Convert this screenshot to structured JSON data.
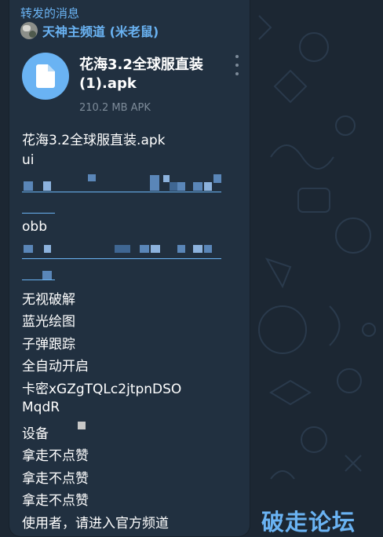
{
  "forwarded_label": "转发的消息",
  "channel_name": "天神主频道 (米老鼠)",
  "file": {
    "name": "花海3.2全球服直装(1).apk",
    "meta": "210.2 MB APK"
  },
  "message_lines": {
    "filename": "花海3.2全球服直装.apk",
    "ui": "ui",
    "obb": "obb",
    "feature1": "无视破解",
    "feature2": "蓝光绘图",
    "feature3": "子弹跟踪",
    "feature4": "全自动开启",
    "key_line1": "卡密xGZgTQLc2jtpnDSO",
    "key_line2": "MqdR",
    "device": "设备",
    "note1": "拿走不点赞",
    "note2": "拿走不点赞",
    "note3": "拿走不点赞",
    "channel_note": "使用者，请进入官方频道"
  },
  "watermark": "破走论坛",
  "colors": {
    "background": "#1c2733",
    "bubble": "#213040",
    "accent": "#6ab3f3",
    "text": "#ffffff",
    "meta": "#7d8b99"
  },
  "icons": [
    "document-icon",
    "more-vertical-icon",
    "channel-avatar"
  ]
}
